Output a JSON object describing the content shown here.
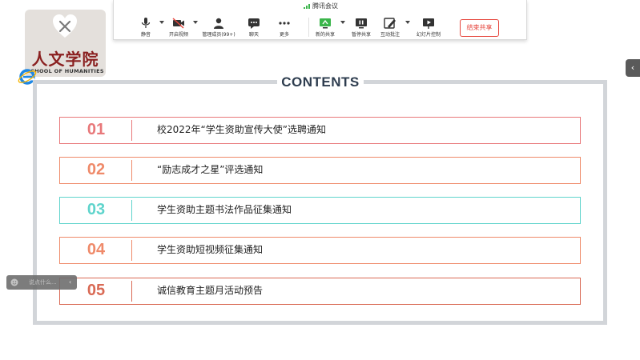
{
  "logo": {
    "title_cn": "人文学院",
    "title_en": "SCHOOL OF HUMANITIES"
  },
  "meeting": {
    "app_title": "腾讯会议",
    "tools": [
      {
        "label": "静音",
        "icon": "microphone-icon"
      },
      {
        "label": "开启视频",
        "icon": "video-off-icon"
      },
      {
        "label": "管理成员(99+)",
        "icon": "members-icon"
      },
      {
        "label": "聊天",
        "icon": "chat-icon"
      },
      {
        "label": "更多",
        "icon": "more-icon"
      },
      {
        "label": "新的共享",
        "icon": "new-share-icon"
      },
      {
        "label": "暂停共享",
        "icon": "pause-share-icon"
      },
      {
        "label": "互动批注",
        "icon": "annotate-icon"
      },
      {
        "label": "幻灯片控制",
        "icon": "slideshow-icon"
      }
    ],
    "end_share_label": "结束共享",
    "accent": "#e6453c"
  },
  "slide": {
    "heading": "CONTENTS",
    "items": [
      {
        "num": "01",
        "text": "校2022年“学生资助宣传大使”选聘通知",
        "color": "#e8787a"
      },
      {
        "num": "02",
        "text": "“励志成才之星”评选通知",
        "color": "#ef8a6a"
      },
      {
        "num": "03",
        "text": "学生资助主题书法作品征集通知",
        "color": "#5fd4cc"
      },
      {
        "num": "04",
        "text": "学生资助短视频征集通知",
        "color": "#ef8a6a"
      },
      {
        "num": "05",
        "text": "诚信教育主题月活动预告",
        "color": "#d96a55"
      }
    ]
  },
  "chat": {
    "placeholder": "说点什么..."
  },
  "side_tab": {
    "glyph": "‹"
  }
}
